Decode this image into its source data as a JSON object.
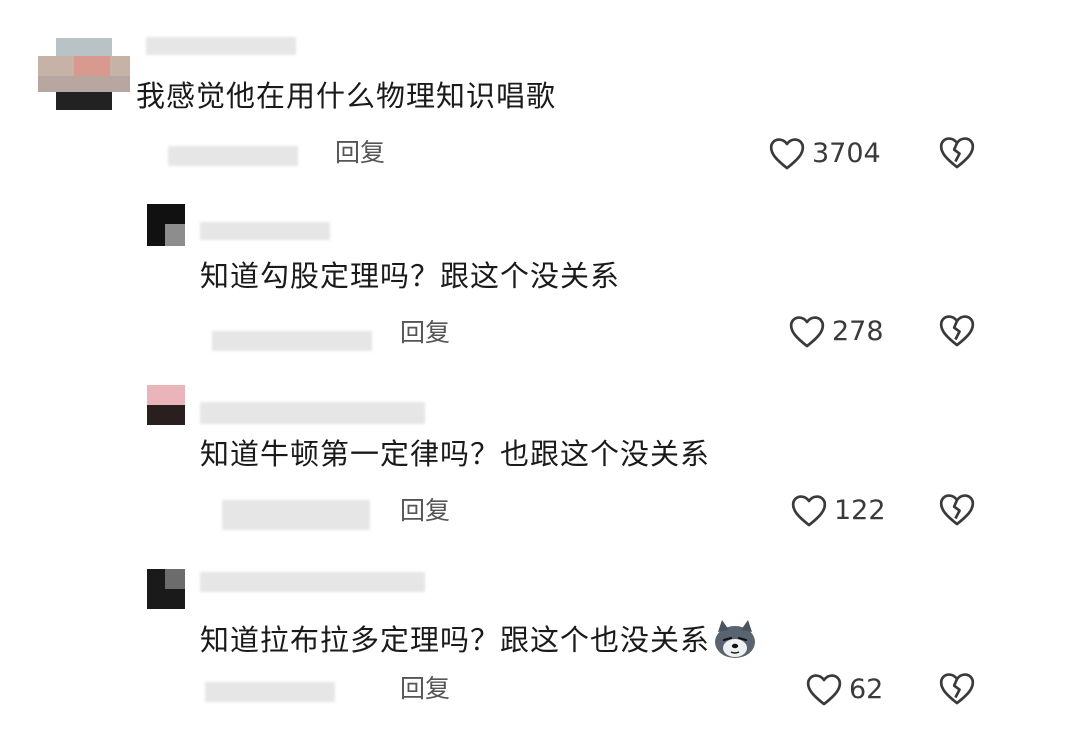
{
  "comments": [
    {
      "text": "我感觉他在用什么物理知识唱歌",
      "reply_label": "回复",
      "likes": "3704"
    },
    {
      "text": "知道勾股定理吗？跟这个没关系",
      "reply_label": "回复",
      "likes": "278"
    },
    {
      "text": "知道牛顿第一定律吗？也跟这个没关系",
      "reply_label": "回复",
      "likes": "122"
    },
    {
      "text": "知道拉布拉多定理吗？跟这个也没关系",
      "reply_label": "回复",
      "likes": "62",
      "emoji": "dog-emoji"
    }
  ],
  "icons": {
    "like": "heart-outline-icon",
    "dislike": "broken-heart-icon"
  },
  "colors": {
    "text": "#1a1a1a",
    "muted": "#555555",
    "icon": "#3a3a3a",
    "blur": "#e6e6e6"
  }
}
